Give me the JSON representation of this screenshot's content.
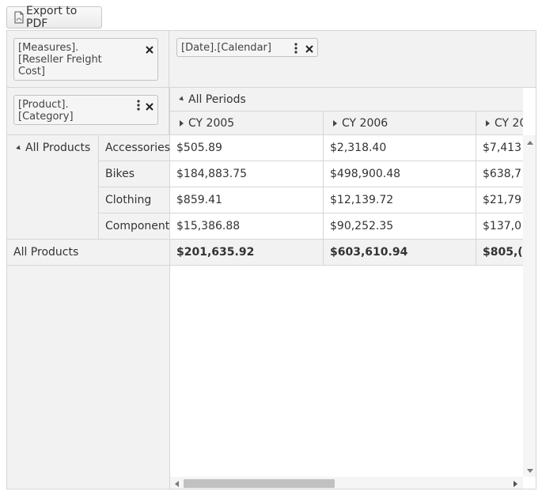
{
  "toolbar": {
    "export_label": "Export to PDF",
    "export_icon": "pdf-file-icon"
  },
  "fields": {
    "measure": "[Measures].\n[Reseller Freight\nCost]",
    "column": "[Date].[Calendar]",
    "row": "[Product].\n[Category]"
  },
  "columns": {
    "group": "All Periods",
    "periods": [
      "CY 2005",
      "CY 2006",
      "CY 20"
    ]
  },
  "rows": {
    "group": "All Products",
    "categories": [
      "Accessories",
      "Bikes",
      "Clothing",
      "Component"
    ],
    "total_label": "All Products"
  },
  "values": [
    [
      "$505.89",
      "$2,318.40",
      "$7,413"
    ],
    [
      "$184,883.75",
      "$498,900.48",
      "$638,7"
    ],
    [
      "$859.41",
      "$12,139.72",
      "$21,79"
    ],
    [
      "$15,386.88",
      "$90,252.35",
      "$137,0"
    ]
  ],
  "totals": [
    "$201,635.92",
    "$603,610.94",
    "$805,("
  ],
  "colors": {
    "header_bg": "#f2f2f2",
    "border": "#d6d6d6",
    "text": "#333333"
  }
}
